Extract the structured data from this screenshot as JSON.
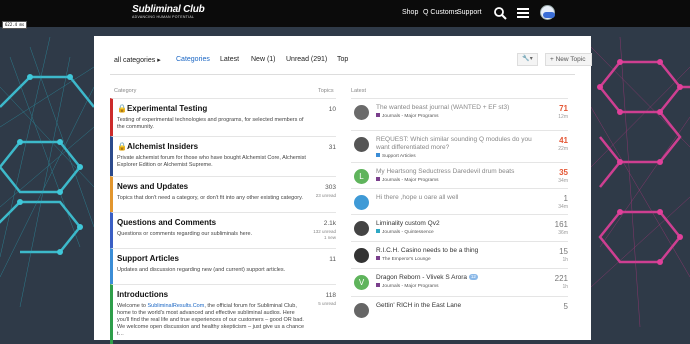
{
  "header": {
    "logo_title": "Subliminal Club",
    "logo_tagline": "ADVANCING HUMAN POTENTIAL",
    "nav": [
      "Shop",
      "Q Customs",
      "Support"
    ],
    "avatar_badge": "",
    "search_icon": "search-icon",
    "menu_icon": "hamburger-menu-icon"
  },
  "debug_overlay": "622.4 ms",
  "toolbar": {
    "all_categories": "all categories",
    "tabs": [
      "Categories",
      "Latest",
      "New (1)",
      "Unread (291)",
      "Top"
    ],
    "new_topic": "New Topic",
    "wrench_icon": "wrench-icon"
  },
  "columns": {
    "category": "Category",
    "topics": "Topics",
    "latest": "Latest"
  },
  "categories": [
    {
      "name": "Experimental Testing",
      "locked": true,
      "desc": "Testing of experimental technologies and programs, for selected members of the community.",
      "count": "10",
      "sub": "",
      "color": "#cc2b2b"
    },
    {
      "name": "Alchemist Insiders",
      "locked": true,
      "desc": "Private alchemist forum for those who have bought Alchemist Core, Alchemist Explorer Edition or Alchemist Supreme.",
      "count": "31",
      "sub": "",
      "color": "#2b4a8c"
    },
    {
      "name": "News and Updates",
      "locked": false,
      "desc": "Topics that don't need a category, or don't fit into any other existing category.",
      "count": "303",
      "sub": "23 unread",
      "color": "#e2962e"
    },
    {
      "name": "Questions and Comments",
      "locked": false,
      "desc": "Questions or comments regarding our subliminals here.",
      "count": "2.1k",
      "sub": "132 unread\n1 new",
      "color": "#3a5fc4"
    },
    {
      "name": "Support Articles",
      "locked": false,
      "desc": "Updates and discussion regarding new (and current) support articles.",
      "count": "11",
      "sub": "",
      "color": "#3b8dd6"
    },
    {
      "name": "Introductions",
      "locked": false,
      "desc_pre": "Welcome to ",
      "desc_link": "SubliminalResults.Com",
      "desc_post": ", the official forum for Subliminal Club, home to the world's most advanced and effective subliminal audios. Here you'll find the real life and true experiences of our customers – good OR bad. We welcome open discussion and healthy skepticism – just give us a chance t…",
      "count": "118",
      "sub": "5 unread",
      "color": "#2e9e4a"
    }
  ],
  "topics": [
    {
      "title": "The wanted beast journal (WANTED + EF st3)",
      "tag": "Journals - Major Programs",
      "tag_color": "#7a3f8c",
      "num": "71",
      "hot": true,
      "age": "12m",
      "avatar": "",
      "avatar_color": "#6b6b6b",
      "read": true
    },
    {
      "title": "REQUEST: Which similar sounding Q modules do you want differentiated more?",
      "tag": "Support Articles",
      "tag_color": "#3b8dd6",
      "num": "41",
      "hot": true,
      "age": "22m",
      "avatar": "",
      "avatar_color": "#555",
      "read": true
    },
    {
      "title": "My Heartsong Seductress Daredevil drum beats",
      "tag": "Journals - Major Programs",
      "tag_color": "#7a3f8c",
      "num": "35",
      "hot": true,
      "age": "34m",
      "avatar": "L",
      "avatar_color": "#5fb45c",
      "read": true
    },
    {
      "title": "Hi there ,hope u oare all well",
      "tag": "",
      "tag_color": "",
      "num": "1",
      "hot": false,
      "age": "34m",
      "avatar": "",
      "avatar_color": "#3f9ad6",
      "read": true
    },
    {
      "title": "Liminality custom Qv2",
      "tag": "Journals - Quintessence",
      "tag_color": "#2ea8c4",
      "num": "161",
      "hot": false,
      "age": "36m",
      "avatar": "",
      "avatar_color": "#444",
      "read": false
    },
    {
      "title": "R.I.C.H. Casino needs to be a thing",
      "tag": "The Emperor's Lounge",
      "tag_color": "#7a3f8c",
      "num": "15",
      "hot": false,
      "age": "1h",
      "avatar": "",
      "avatar_color": "#333",
      "read": false
    },
    {
      "title": "Dragon Reborn - Vlivek S Arora",
      "pill": "12",
      "tag": "Journals - Major Programs",
      "tag_color": "#7a3f8c",
      "num": "221",
      "hot": false,
      "age": "1h",
      "avatar": "V",
      "avatar_color": "#5fb45c",
      "read": false
    },
    {
      "title": "Gettin' RICH in the East Lane",
      "tag": "",
      "tag_color": "",
      "num": "5",
      "hot": false,
      "age": "",
      "avatar": "",
      "avatar_color": "#666",
      "read": false
    }
  ]
}
